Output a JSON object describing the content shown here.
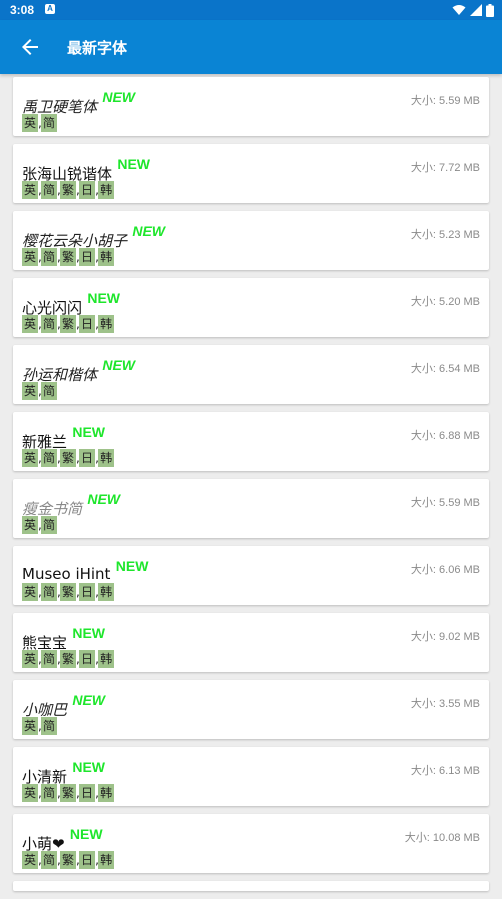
{
  "status_bar": {
    "time": "3:08",
    "notification_icon": "A"
  },
  "app_bar": {
    "title": "最新字体",
    "back_icon": "arrow-back-icon"
  },
  "badge_label": "NEW",
  "tag_separator": ",",
  "colors": {
    "status_bar": "#0a74c9",
    "app_bar": "#0a84d4",
    "badge": "#1ee62c",
    "tag_bg": "#9ec28a",
    "background": "#ededed"
  },
  "fonts": [
    {
      "name": "禹卫硬笔体",
      "size": "大小: 5.59 MB",
      "tags": [
        "英",
        "简"
      ]
    },
    {
      "name": "张海山锐谐体",
      "size": "大小: 7.72 MB",
      "tags": [
        "英",
        "简",
        "繁",
        "日",
        "韩"
      ]
    },
    {
      "name": "樱花云朵小胡子",
      "size": "大小: 5.23 MB",
      "tags": [
        "英",
        "简",
        "繁",
        "日",
        "韩"
      ]
    },
    {
      "name": "心光闪闪",
      "size": "大小: 5.20 MB",
      "tags": [
        "英",
        "简",
        "繁",
        "日",
        "韩"
      ]
    },
    {
      "name": "孙运和楷体",
      "size": "大小: 6.54 MB",
      "tags": [
        "英",
        "简"
      ]
    },
    {
      "name": "新雅兰",
      "size": "大小: 6.88 MB",
      "tags": [
        "英",
        "简",
        "繁",
        "日",
        "韩"
      ]
    },
    {
      "name": "瘦金书简",
      "size": "大小: 5.59 MB",
      "tags": [
        "英",
        "简"
      ]
    },
    {
      "name": "Museo iHint",
      "size": "大小: 6.06 MB",
      "tags": [
        "英",
        "简",
        "繁",
        "日",
        "韩"
      ]
    },
    {
      "name": "熊宝宝",
      "size": "大小: 9.02 MB",
      "tags": [
        "英",
        "简",
        "繁",
        "日",
        "韩"
      ]
    },
    {
      "name": "小咖巴",
      "size": "大小: 3.55 MB",
      "tags": [
        "英",
        "简"
      ]
    },
    {
      "name": "小清新",
      "size": "大小: 6.13 MB",
      "tags": [
        "英",
        "简",
        "繁",
        "日",
        "韩"
      ]
    },
    {
      "name": "小萌❤",
      "size": "大小: 10.08 MB",
      "tags": [
        "英",
        "简",
        "繁",
        "日",
        "韩"
      ]
    }
  ]
}
